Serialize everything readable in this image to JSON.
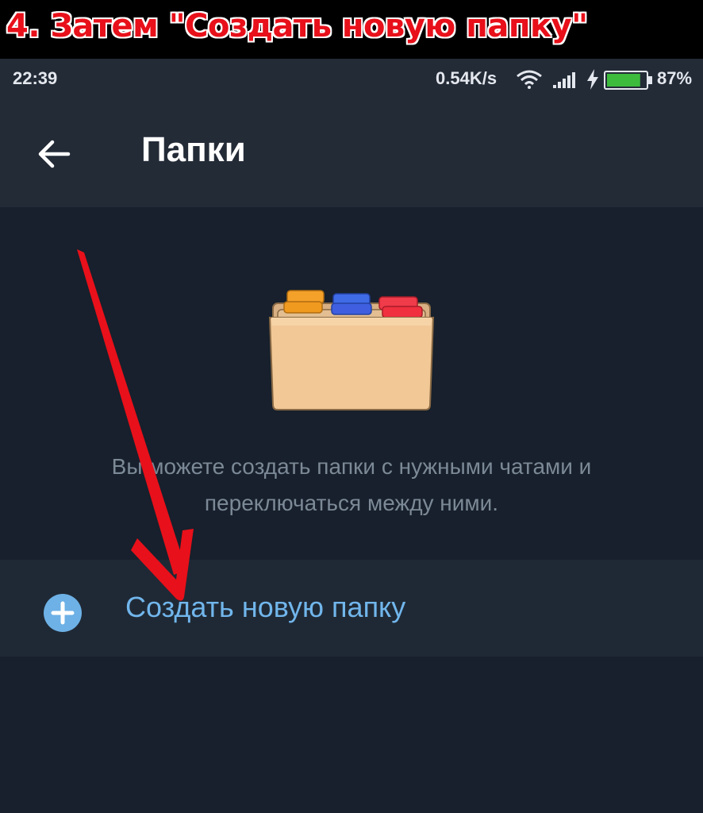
{
  "caption": "4. Затем \"Создать новую папку\"",
  "status_bar": {
    "time": "22:39",
    "network_speed": "0.54K/s",
    "battery_percent": "87%",
    "battery_level": 0.87
  },
  "header": {
    "title": "Папки"
  },
  "empty_state": {
    "description": "Вы можете создать папки с нужными чатами и переключаться между ними."
  },
  "create_folder": {
    "label": "Создать новую папку"
  },
  "colors": {
    "accent": "#71b6ec",
    "background": "#17202c",
    "header": "#232b37",
    "arrow": "#e8101a",
    "battery": "#3dbb3d"
  }
}
